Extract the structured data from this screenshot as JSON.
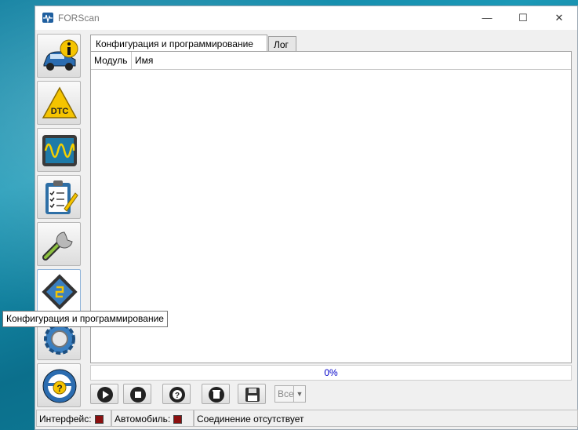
{
  "window": {
    "title": "FORScan",
    "controls": {
      "minimize": "—",
      "maximize": "☐",
      "close": "✕"
    }
  },
  "sidebar": {
    "items": [
      {
        "name": "vehicle-info",
        "icon": "car-info-icon"
      },
      {
        "name": "dtc",
        "icon": "dtc-warning-icon",
        "label": "DTC"
      },
      {
        "name": "oscilloscope",
        "icon": "oscilloscope-icon"
      },
      {
        "name": "tests",
        "icon": "checklist-icon"
      },
      {
        "name": "service",
        "icon": "wrench-icon"
      },
      {
        "name": "configuration",
        "icon": "chip-icon",
        "active": true
      },
      {
        "name": "settings",
        "icon": "gear-icon"
      },
      {
        "name": "help",
        "icon": "help-wheel-icon",
        "label": "?"
      }
    ]
  },
  "tabs": [
    {
      "label": "Конфигурация и программирование",
      "selected": true
    },
    {
      "label": "Лог",
      "selected": false
    }
  ],
  "table": {
    "columns": [
      "Модуль",
      "Имя"
    ]
  },
  "progress": {
    "text": "0%",
    "value": 0
  },
  "toolbar": {
    "buttons": [
      "play-icon",
      "stop-icon",
      "help-lifebuoy-icon",
      "delete-icon",
      "save-icon"
    ],
    "filter": {
      "value": "Все"
    }
  },
  "status": {
    "interface_label": "Интерфейс:",
    "vehicle_label": "Автомобиль:",
    "connection_text": "Соединение отсутствует",
    "led_color": "#8a1010"
  },
  "tooltip": {
    "text": "Конфигурация и программирование"
  }
}
